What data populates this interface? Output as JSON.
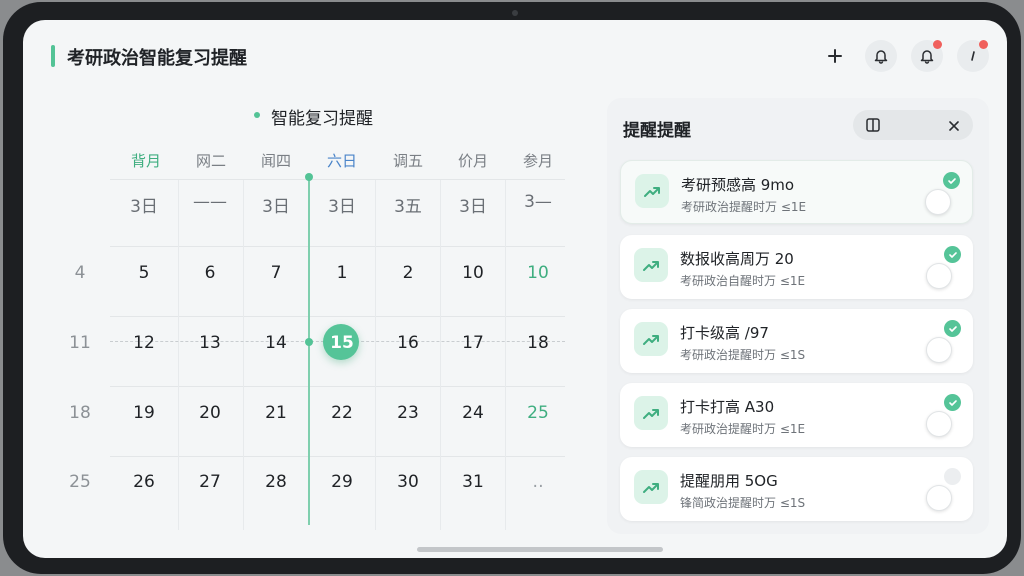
{
  "header": {
    "title": "考研政治智能复习提醒",
    "buttons": [
      {
        "icon": "plus-icon"
      },
      {
        "icon": "bell-icon"
      },
      {
        "icon": "bell-icon",
        "badge": true
      },
      {
        "icon": "more-vertical-icon",
        "badge": true
      }
    ]
  },
  "calendar": {
    "title": "智能复习提醒",
    "weekdays": [
      "背月",
      "网二",
      "闻四",
      "六日",
      "调五",
      "价月",
      "参月"
    ],
    "top_row": [
      "3日",
      "——",
      "3日",
      "3日",
      "3五",
      "3日",
      "3—"
    ],
    "weeks": [
      {
        "num": "4",
        "days": [
          "5",
          "6",
          "7",
          "1",
          "2",
          "10",
          "10"
        ]
      },
      {
        "num": "11",
        "days": [
          "12",
          "13",
          "14",
          "15",
          "16",
          "17",
          "18"
        ]
      },
      {
        "num": "18",
        "days": [
          "19",
          "20",
          "21",
          "22",
          "23",
          "24",
          "25"
        ]
      },
      {
        "num": "25",
        "days": [
          "26",
          "27",
          "28",
          "29",
          "30",
          "31",
          "‥"
        ]
      }
    ],
    "today": "15"
  },
  "panel": {
    "title": "提醒提醒",
    "items": [
      {
        "title": "考研预感高 9mo",
        "subtitle": "考研政治提醒时万 ≤1E",
        "checked": true
      },
      {
        "title": "数报收高周万 20",
        "subtitle": "考研政治自醒时万 ≤1E",
        "checked": true
      },
      {
        "title": "打卡级高 /97",
        "subtitle": "考研政治提醒时万 ≤1S",
        "checked": true
      },
      {
        "title": "打卡打高 A30",
        "subtitle": "考研政治提醒时万 ≤1E",
        "checked": true
      },
      {
        "title": "提醒朋用 5OG",
        "subtitle": "锋简政治提醒时万 ≤1S",
        "checked": false
      }
    ]
  },
  "colors": {
    "accent": "#55c498",
    "badge": "#f0605c"
  }
}
